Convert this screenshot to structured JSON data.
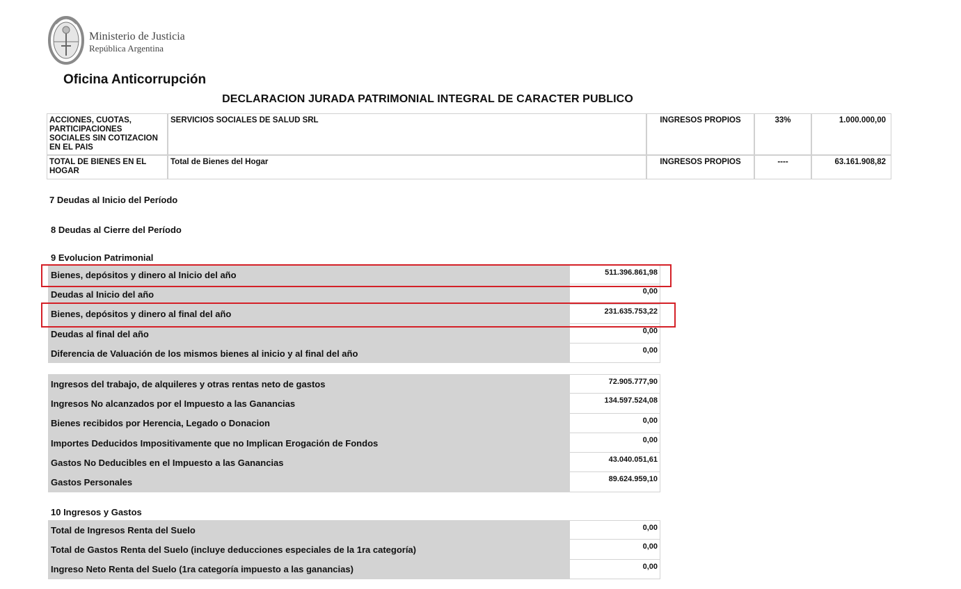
{
  "header": {
    "ministry_line1": "Ministerio de Justicia",
    "ministry_line2": "República Argentina",
    "office": "Oficina Anticorrupción",
    "title": "DECLARACION JURADA PATRIMONIAL INTEGRAL DE CARACTER PUBLICO"
  },
  "assets_table": [
    {
      "type": "ACCIONES, CUOTAS, PARTICIPACIONES SOCIALES SIN COTIZACION EN EL PAIS",
      "description": "SERVICIOS SOCIALES DE SALUD SRL",
      "origin": "INGRESOS PROPIOS",
      "percent": "33%",
      "amount": "1.000.000,00"
    },
    {
      "type": "TOTAL DE BIENES EN EL HOGAR",
      "description": "Total de Bienes del Hogar",
      "origin": "INGRESOS PROPIOS",
      "percent": "----",
      "amount": "63.161.908,82"
    }
  ],
  "sections": {
    "s7": "7 Deudas al Inicio del Período",
    "s8": "8 Deudas al Cierre del Período",
    "s9": "9 Evolucion Patrimonial",
    "s10": "10 Ingresos y Gastos"
  },
  "evolucion_a": [
    {
      "label": "Bienes, depósitos y dinero al Inicio del año",
      "value": "511.396.861,98"
    },
    {
      "label": "Deudas al Inicio del año",
      "value": "0,00"
    },
    {
      "label": "Bienes, depósitos y dinero al final del año",
      "value": "231.635.753,22"
    },
    {
      "label": "Deudas al final del año",
      "value": "0,00"
    },
    {
      "label": "Diferencia de Valuación de los mismos bienes al inicio y al final del año",
      "value": "0,00"
    }
  ],
  "evolucion_b": [
    {
      "label": "Ingresos del trabajo, de alquileres y otras rentas neto de gastos",
      "value": "72.905.777,90"
    },
    {
      "label": "Ingresos No alcanzados por el Impuesto a las Ganancias",
      "value": "134.597.524,08"
    },
    {
      "label": "Bienes recibidos por Herencia, Legado o Donacion",
      "value": "0,00"
    },
    {
      "label": "Importes Deducidos Impositivamente que no Implican Erogación de Fondos",
      "value": "0,00"
    },
    {
      "label": "Gastos No Deducibles en el Impuesto a las Ganancias",
      "value": "43.040.051,61"
    },
    {
      "label": "Gastos Personales",
      "value": "89.624.959,10"
    }
  ],
  "ingresos_gastos": [
    {
      "label": "Total de Ingresos Renta del Suelo",
      "value": "0,00"
    },
    {
      "label": "Total de Gastos Renta del Suelo (incluye deducciones especiales de la 1ra categoría)",
      "value": "0,00"
    },
    {
      "label": "Ingreso Neto Renta del Suelo (1ra categoría impuesto a las ganancias)",
      "value": "0,00"
    }
  ],
  "colors": {
    "highlight": "#d42027",
    "label_bg": "#d3d3d3"
  }
}
